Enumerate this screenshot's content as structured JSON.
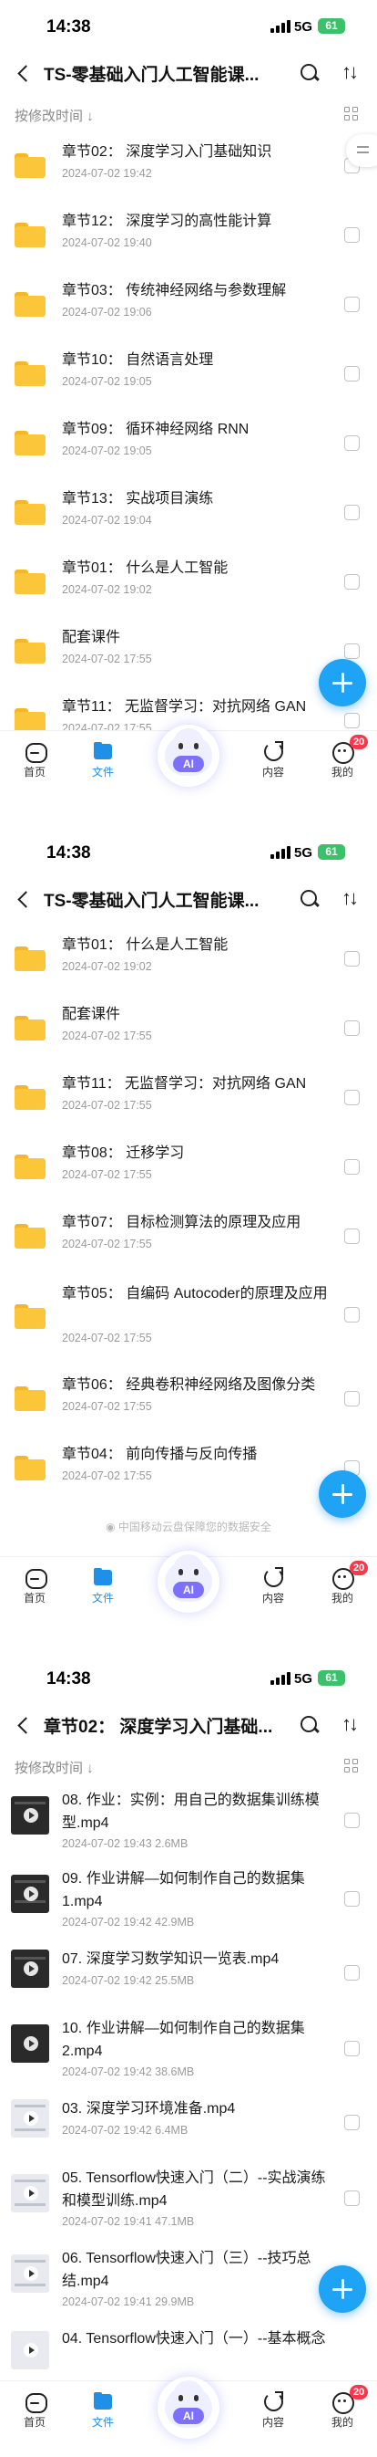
{
  "status": {
    "time": "14:38",
    "network": "5G",
    "battery": "61"
  },
  "screens": [
    {
      "title": "TS-零基础入门人工智能课...",
      "sort_label": "按修改时间 ↓",
      "rows": [
        {
          "name": "章节02：  深度学习入门基础知识",
          "meta": "2024-07-02 19:42"
        },
        {
          "name": "章节12：  深度学习的高性能计算",
          "meta": "2024-07-02 19:40"
        },
        {
          "name": "章节03：  传统神经网络与参数理解",
          "meta": "2024-07-02 19:06"
        },
        {
          "name": "章节10：  自然语言处理",
          "meta": "2024-07-02 19:05"
        },
        {
          "name": "章节09：  循环神经网络 RNN",
          "meta": "2024-07-02 19:05"
        },
        {
          "name": "章节13：  实战项目演练",
          "meta": "2024-07-02 19:04"
        },
        {
          "name": "章节01：  什么是人工智能",
          "meta": "2024-07-02 19:02"
        },
        {
          "name": "配套课件",
          "meta": "2024-07-02 17:55"
        },
        {
          "name": "章节11：  无监督学习：对抗网络 GAN",
          "meta": "2024-07-02 17:55"
        }
      ]
    },
    {
      "title": "TS-零基础入门人工智能课...",
      "rows": [
        {
          "name": "章节01：  什么是人工智能",
          "meta": "2024-07-02 19:02"
        },
        {
          "name": "配套课件",
          "meta": "2024-07-02 17:55"
        },
        {
          "name": "章节11：  无监督学习：对抗网络 GAN",
          "meta": "2024-07-02 17:55"
        },
        {
          "name": "章节08：  迁移学习",
          "meta": "2024-07-02 17:55"
        },
        {
          "name": "章节07：  目标检测算法的原理及应用",
          "meta": "2024-07-02 17:55"
        },
        {
          "name": "章节05：  自编码 Autocoder的原理及应用",
          "meta": "2024-07-02 17:55"
        },
        {
          "name": "章节06：  经典卷积神经网络及图像分类",
          "meta": "2024-07-02 17:55"
        },
        {
          "name": "章节04：  前向传播与反向传播",
          "meta": "2024-07-02 17:55"
        }
      ],
      "safety_notice": "中国移动云盘保障您的数据安全"
    },
    {
      "title": "章节02：  深度学习入门基础...",
      "sort_label": "按修改时间 ↓",
      "rows": [
        {
          "name": "08. 作业：实例：用自己的数据集训练模型.mp4",
          "meta": "2024-07-02 19:43   2.6MB"
        },
        {
          "name": "09. 作业讲解—如何制作自己的数据集1.mp4",
          "meta": "2024-07-02 19:42   42.9MB"
        },
        {
          "name": "07. 深度学习数学知识一览表.mp4",
          "meta": "2024-07-02 19:42   25.5MB"
        },
        {
          "name": "10. 作业讲解—如何制作自己的数据集2.mp4",
          "meta": "2024-07-02 19:42   38.6MB"
        },
        {
          "name": "03. 深度学习环境准备.mp4",
          "meta": "2024-07-02 19:42   6.4MB"
        },
        {
          "name": "05. Tensorflow快速入门（二）--实战演练和模型训练.mp4",
          "meta": "2024-07-02 19:41   47.1MB"
        },
        {
          "name": "06. Tensorflow快速入门（三）--技巧总结.mp4",
          "meta": "2024-07-02 19:41   29.9MB"
        },
        {
          "name": "04. Tensorflow快速入门（一）--基本概念",
          "meta": ""
        }
      ]
    }
  ],
  "tabbar": {
    "home": "首页",
    "files": "文件",
    "ai": "AI",
    "content": "内容",
    "mine": "我的",
    "badge": "20"
  },
  "icons": {
    "back": "back-chevron-icon",
    "search": "search-icon",
    "sort": "sort-arrows-icon",
    "view": "grid-view-icon",
    "folder": "folder-icon",
    "video": "video-file-icon",
    "add": "plus-icon"
  },
  "colors": {
    "accent": "#1fa3f5",
    "folder": "#fcc63a",
    "badge": "#f5394a",
    "battery": "#3ac16a",
    "ai": "#7d70ff"
  }
}
